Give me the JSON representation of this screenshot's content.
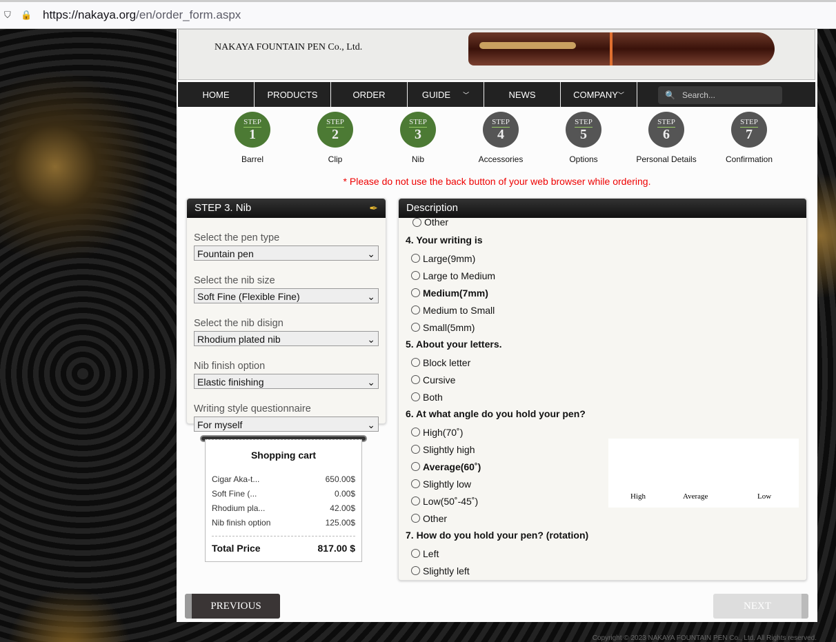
{
  "browser": {
    "url_host": "https://nakaya.org",
    "url_path": "/en/order_form.aspx"
  },
  "header": {
    "company": "NAKAYA FOUNTAIN PEN Co., Ltd."
  },
  "nav": {
    "items": [
      "HOME",
      "PRODUCTS",
      "ORDER",
      "GUIDE",
      "NEWS",
      "COMPANY"
    ],
    "search_placeholder": "Search..."
  },
  "steps": {
    "prefix": "STEP",
    "items": [
      {
        "n": "1",
        "label": "Barrel",
        "done": true
      },
      {
        "n": "2",
        "label": "Clip",
        "done": true
      },
      {
        "n": "3",
        "label": "Nib",
        "done": true
      },
      {
        "n": "4",
        "label": "Accessories",
        "done": false
      },
      {
        "n": "5",
        "label": "Options",
        "done": false
      },
      {
        "n": "6",
        "label": "Personal Details",
        "done": false
      },
      {
        "n": "7",
        "label": "Confirmation",
        "done": false
      }
    ]
  },
  "warning": "* Please do not use the back button of your web browser while ordering.",
  "form": {
    "title": "STEP 3. Nib",
    "fields": [
      {
        "label": "Select the pen type",
        "value": "Fountain pen"
      },
      {
        "label": "Select the nib size",
        "value": "Soft Fine (Flexible Fine)"
      },
      {
        "label": "Select the nib disign",
        "value": "Rhodium plated nib"
      },
      {
        "label": "Nib finish option",
        "value": "Elastic finishing"
      },
      {
        "label": "Writing style questionnaire",
        "value": "For myself"
      }
    ]
  },
  "cart": {
    "title": "Shopping cart",
    "items": [
      {
        "name": "Cigar Aka-t...",
        "price": "650.00$"
      },
      {
        "name": "Soft Fine (...",
        "price": "0.00$"
      },
      {
        "name": "Rhodium pla...",
        "price": "42.00$"
      },
      {
        "name": "Nib finish option",
        "price": "125.00$"
      }
    ],
    "total_label": "Total Price",
    "total": "817.00 $"
  },
  "description": {
    "title": "Description",
    "top_option": "Other",
    "q4": {
      "q": "4. Your writing is",
      "options": [
        "Large(9mm)",
        "Large to Medium",
        "Medium(7mm)",
        "Medium to Small",
        "Small(5mm)"
      ]
    },
    "q5": {
      "q": "5. About your letters.",
      "options": [
        "Block letter",
        "Cursive",
        "Both"
      ]
    },
    "q6": {
      "q": "6. At what angle do you hold your pen?",
      "options": [
        "High(70˚)",
        "Slightly high",
        "Average(60˚)",
        "Slightly low",
        "Low(50˚-45˚)",
        "Other"
      ],
      "image_labels": [
        "High",
        "Average",
        "Low"
      ]
    },
    "q7": {
      "q": "7. How do you hold your pen? (rotation)",
      "options": [
        "Left",
        "Slightly left"
      ]
    }
  },
  "buttons": {
    "previous": "PREVIOUS",
    "next": "NEXT"
  },
  "footer": "Copyright © 2023 NAKAYA FOUNTAIN PEN Co., Ltd. All Rights reserved."
}
